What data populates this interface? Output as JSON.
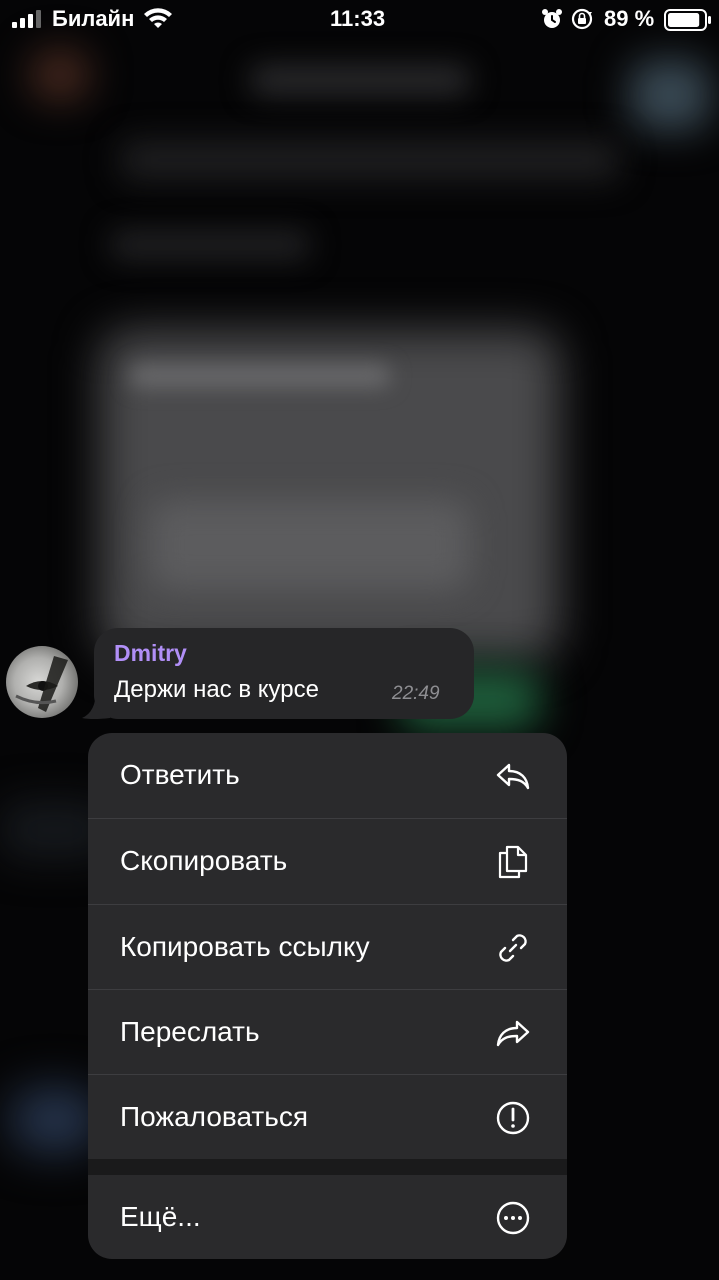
{
  "status_bar": {
    "carrier": "Билайн",
    "time": "11:33",
    "battery_percent": "89 %",
    "battery_level": 0.89,
    "icons": [
      "cellular-signal-icon",
      "wifi-icon",
      "alarm-icon",
      "orientation-lock-icon",
      "battery-icon"
    ]
  },
  "message": {
    "sender": "Dmitry",
    "text": "Держи нас в курсе",
    "time": "22:49",
    "sender_color": "#b18ff7"
  },
  "context_menu": {
    "items": [
      {
        "label": "Ответить",
        "icon": "reply-icon"
      },
      {
        "label": "Скопировать",
        "icon": "copy-icon"
      },
      {
        "label": "Копировать ссылку",
        "icon": "link-icon"
      },
      {
        "label": "Переслать",
        "icon": "forward-icon"
      },
      {
        "label": "Пожаловаться",
        "icon": "report-icon"
      }
    ],
    "more": {
      "label": "Ещё...",
      "icon": "more-icon"
    }
  }
}
